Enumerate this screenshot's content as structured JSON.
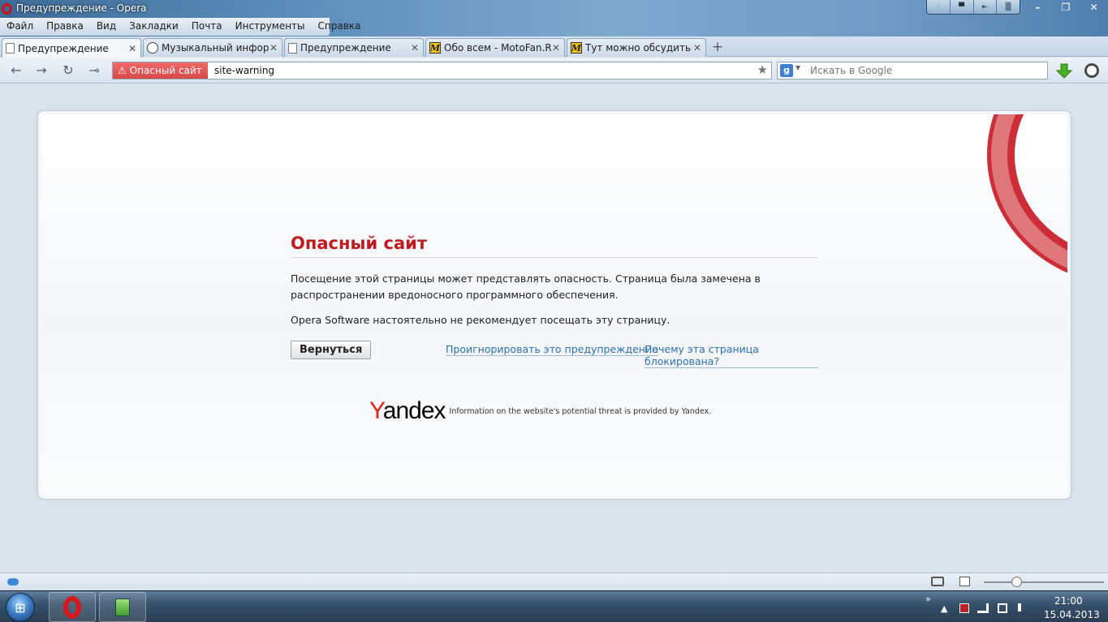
{
  "window": {
    "title": "Предупреждение - Opera",
    "controls": [
      "·",
      "▀",
      "⇤",
      "▒"
    ],
    "wm_controls": [
      "–",
      "❐",
      "✕"
    ]
  },
  "menu": {
    "items": [
      "Файл",
      "Правка",
      "Вид",
      "Закладки",
      "Почта",
      "Инструменты",
      "Справка"
    ]
  },
  "tabs": [
    {
      "label": "Предупреждение",
      "icon": "page-icon",
      "active": true
    },
    {
      "label": "Музыкальный инфор...",
      "icon": "music-icon",
      "active": false
    },
    {
      "label": "Предупреждение",
      "icon": "page-icon",
      "active": false
    },
    {
      "label": "Обо всем - MotoFan.R...",
      "icon": "motofan-icon",
      "active": false
    },
    {
      "label": "Тут можно обсудить р...",
      "icon": "motofan-icon",
      "active": false
    }
  ],
  "tab_close_glyph": "✕",
  "new_tab_glyph": "+",
  "address_bar": {
    "badge_icon": "⚠",
    "badge_label": "Опасный сайт",
    "url": "site-warning",
    "star_glyph": "★"
  },
  "search": {
    "engine_glyph": "g",
    "dropdown_glyph": "▼",
    "placeholder": "Искать в Google"
  },
  "nav_glyphs": {
    "back": "←",
    "forward": "→",
    "reload": "↻",
    "key": "⊸"
  },
  "warning": {
    "title": "Опасный сайт",
    "description": "Посещение этой страницы может представлять опасность. Страница была замечена в распространении вредоносного программного обеспечения.",
    "advice": "Opera Software настоятельно не рекомендует посещать эту страницу.",
    "back_button": "Вернуться",
    "ignore_link": "Проигнорировать это предупреждение",
    "why_link": "Почему эта страница блокирована?"
  },
  "yandex": {
    "logo_first": "Y",
    "logo_rest": "andex",
    "note": "Information on the website's potential threat is provided by Yandex."
  },
  "taskbar": {
    "start_glyph": "⊞",
    "tray_chevron": "»",
    "tray_up": "▲",
    "time": "21:00",
    "date": "15.04.2013"
  },
  "colors": {
    "danger": "#c0191f",
    "badge": "#d94848",
    "link": "#2c6fb3"
  }
}
